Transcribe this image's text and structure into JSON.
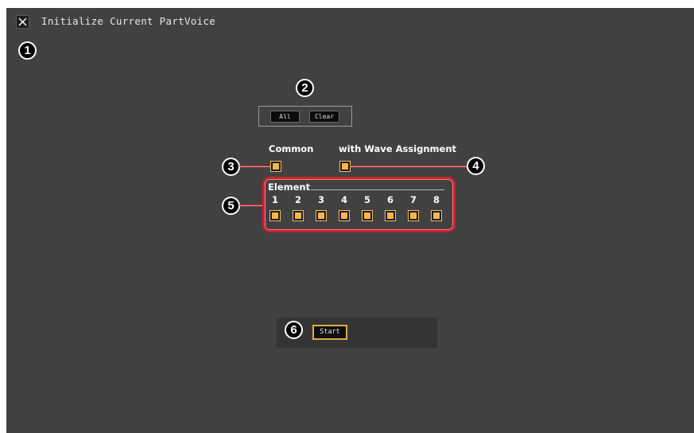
{
  "window": {
    "title": "Initialize Current PartVoice",
    "close_icon": "close-x-icon"
  },
  "callouts": [
    "1",
    "2",
    "3",
    "4",
    "5",
    "6"
  ],
  "selection": {
    "all_label": "All",
    "clear_label": "Clear"
  },
  "options": {
    "common_label": "Common",
    "wave_assignment_label": "with Wave Assignment"
  },
  "element": {
    "title": "Element",
    "numbers": [
      "1",
      "2",
      "3",
      "4",
      "5",
      "6",
      "7",
      "8"
    ]
  },
  "actions": {
    "start_label": "Start"
  },
  "colors": {
    "background": "#414141",
    "checkbox": "#f4b84a",
    "highlight": "#c7242e",
    "start_border": "#e1ac43"
  }
}
